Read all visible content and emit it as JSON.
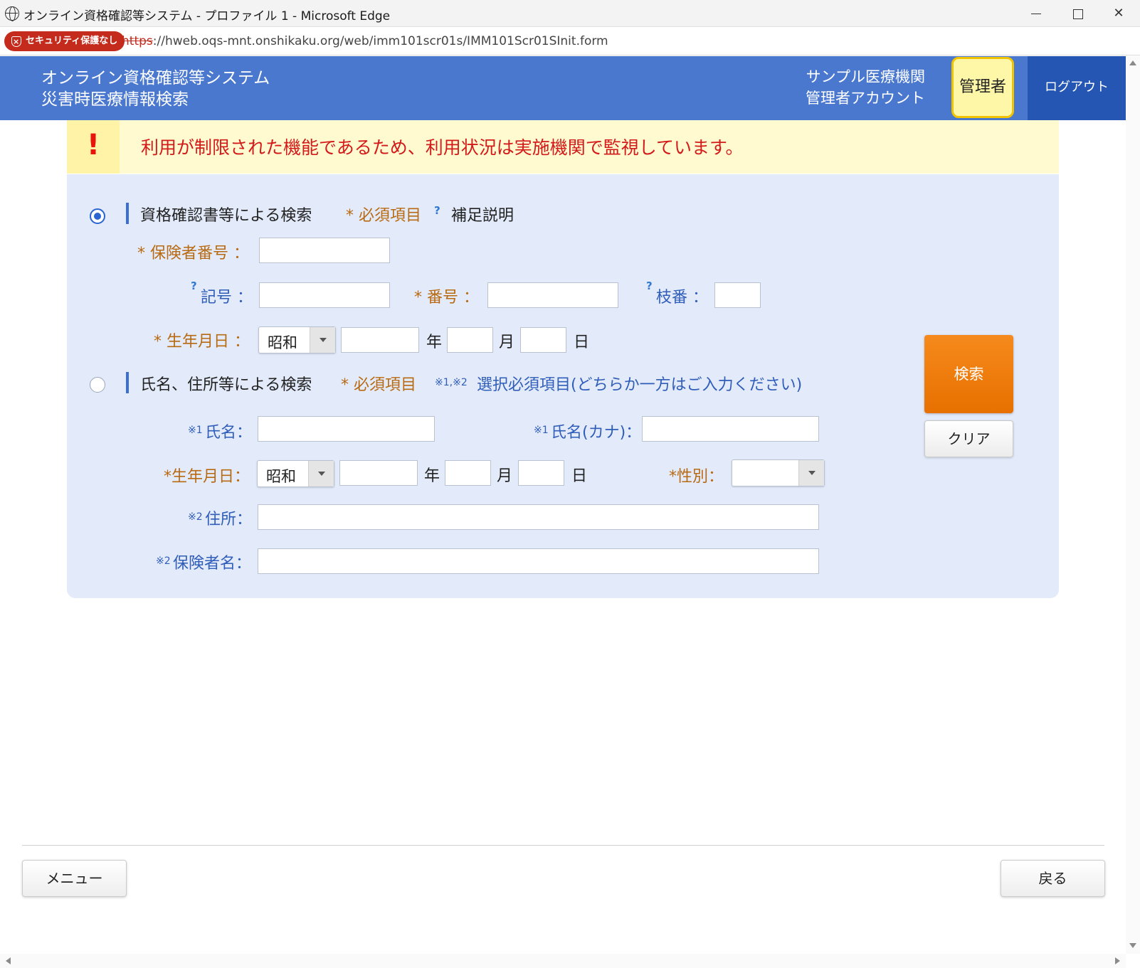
{
  "window": {
    "title": "オンライン資格確認等システム - プロファイル 1 - Microsoft Edge",
    "security_badge": "セキュリティ保護なし",
    "url_scheme": "https",
    "url_rest": "://hweb.oqs-mnt.onshikaku.org/web/imm101scr01s/IMM101Scr01SInit.form"
  },
  "header": {
    "app_title_line1": "オンライン資格確認等システム",
    "app_title_line2": "災害時医療情報検索",
    "facility_name": "サンプル医療機関",
    "account_name": "管理者アカウント",
    "role_badge": "管理者",
    "logout_label": "ログアウト"
  },
  "warning": {
    "icon": "!",
    "message": "利用が制限された機能であるため、利用状況は実施機関で監視しています。"
  },
  "section1": {
    "selected": true,
    "title": "資格確認書等による検索",
    "required_note": "* 必須項目",
    "help_mark": "?",
    "help_note": "補足説明",
    "insurer_number_label": "* 保険者番号 ：",
    "symbol_help": "?",
    "symbol_label": "記号 ：",
    "number_label": "* 番号 ：",
    "branch_help": "?",
    "branch_label": "枝番 ：",
    "birthdate_label": "* 生年月日 ：",
    "era_value": "昭和",
    "year_unit": "年",
    "month_unit": "月",
    "day_unit": "日"
  },
  "section2": {
    "selected": false,
    "title": "氏名、住所等による検索",
    "required_note": "* 必須項目",
    "select_note_mark": "※1,※2",
    "select_note": "選択必須項目(どちらか一方はご入力ください)",
    "name_mark": "※1",
    "name_label": "氏名：",
    "kana_mark": "※1",
    "kana_label": "氏名(カナ)：",
    "birthdate_label": "*生年月日：",
    "era_value": "昭和",
    "year_unit": "年",
    "month_unit": "月",
    "day_unit": "日",
    "gender_label": "*性別：",
    "gender_value": "",
    "address_mark": "※2",
    "address_label": "住所：",
    "insurer_name_mark": "※2",
    "insurer_name_label": "保険者名："
  },
  "actions": {
    "search_label": "検索",
    "clear_label": "クリア"
  },
  "footer": {
    "menu_label": "メニュー",
    "back_label": "戻る"
  },
  "colors": {
    "header_blue": "#4a78cf",
    "logout_blue": "#2656b3",
    "admin_badge_yellow": "#fff7a8",
    "warning_bg": "#fffad0",
    "warning_text": "#d31a1a",
    "panel_bg": "#e3ebfb",
    "required_orange": "#b86a12",
    "search_orange": "#f28000"
  }
}
